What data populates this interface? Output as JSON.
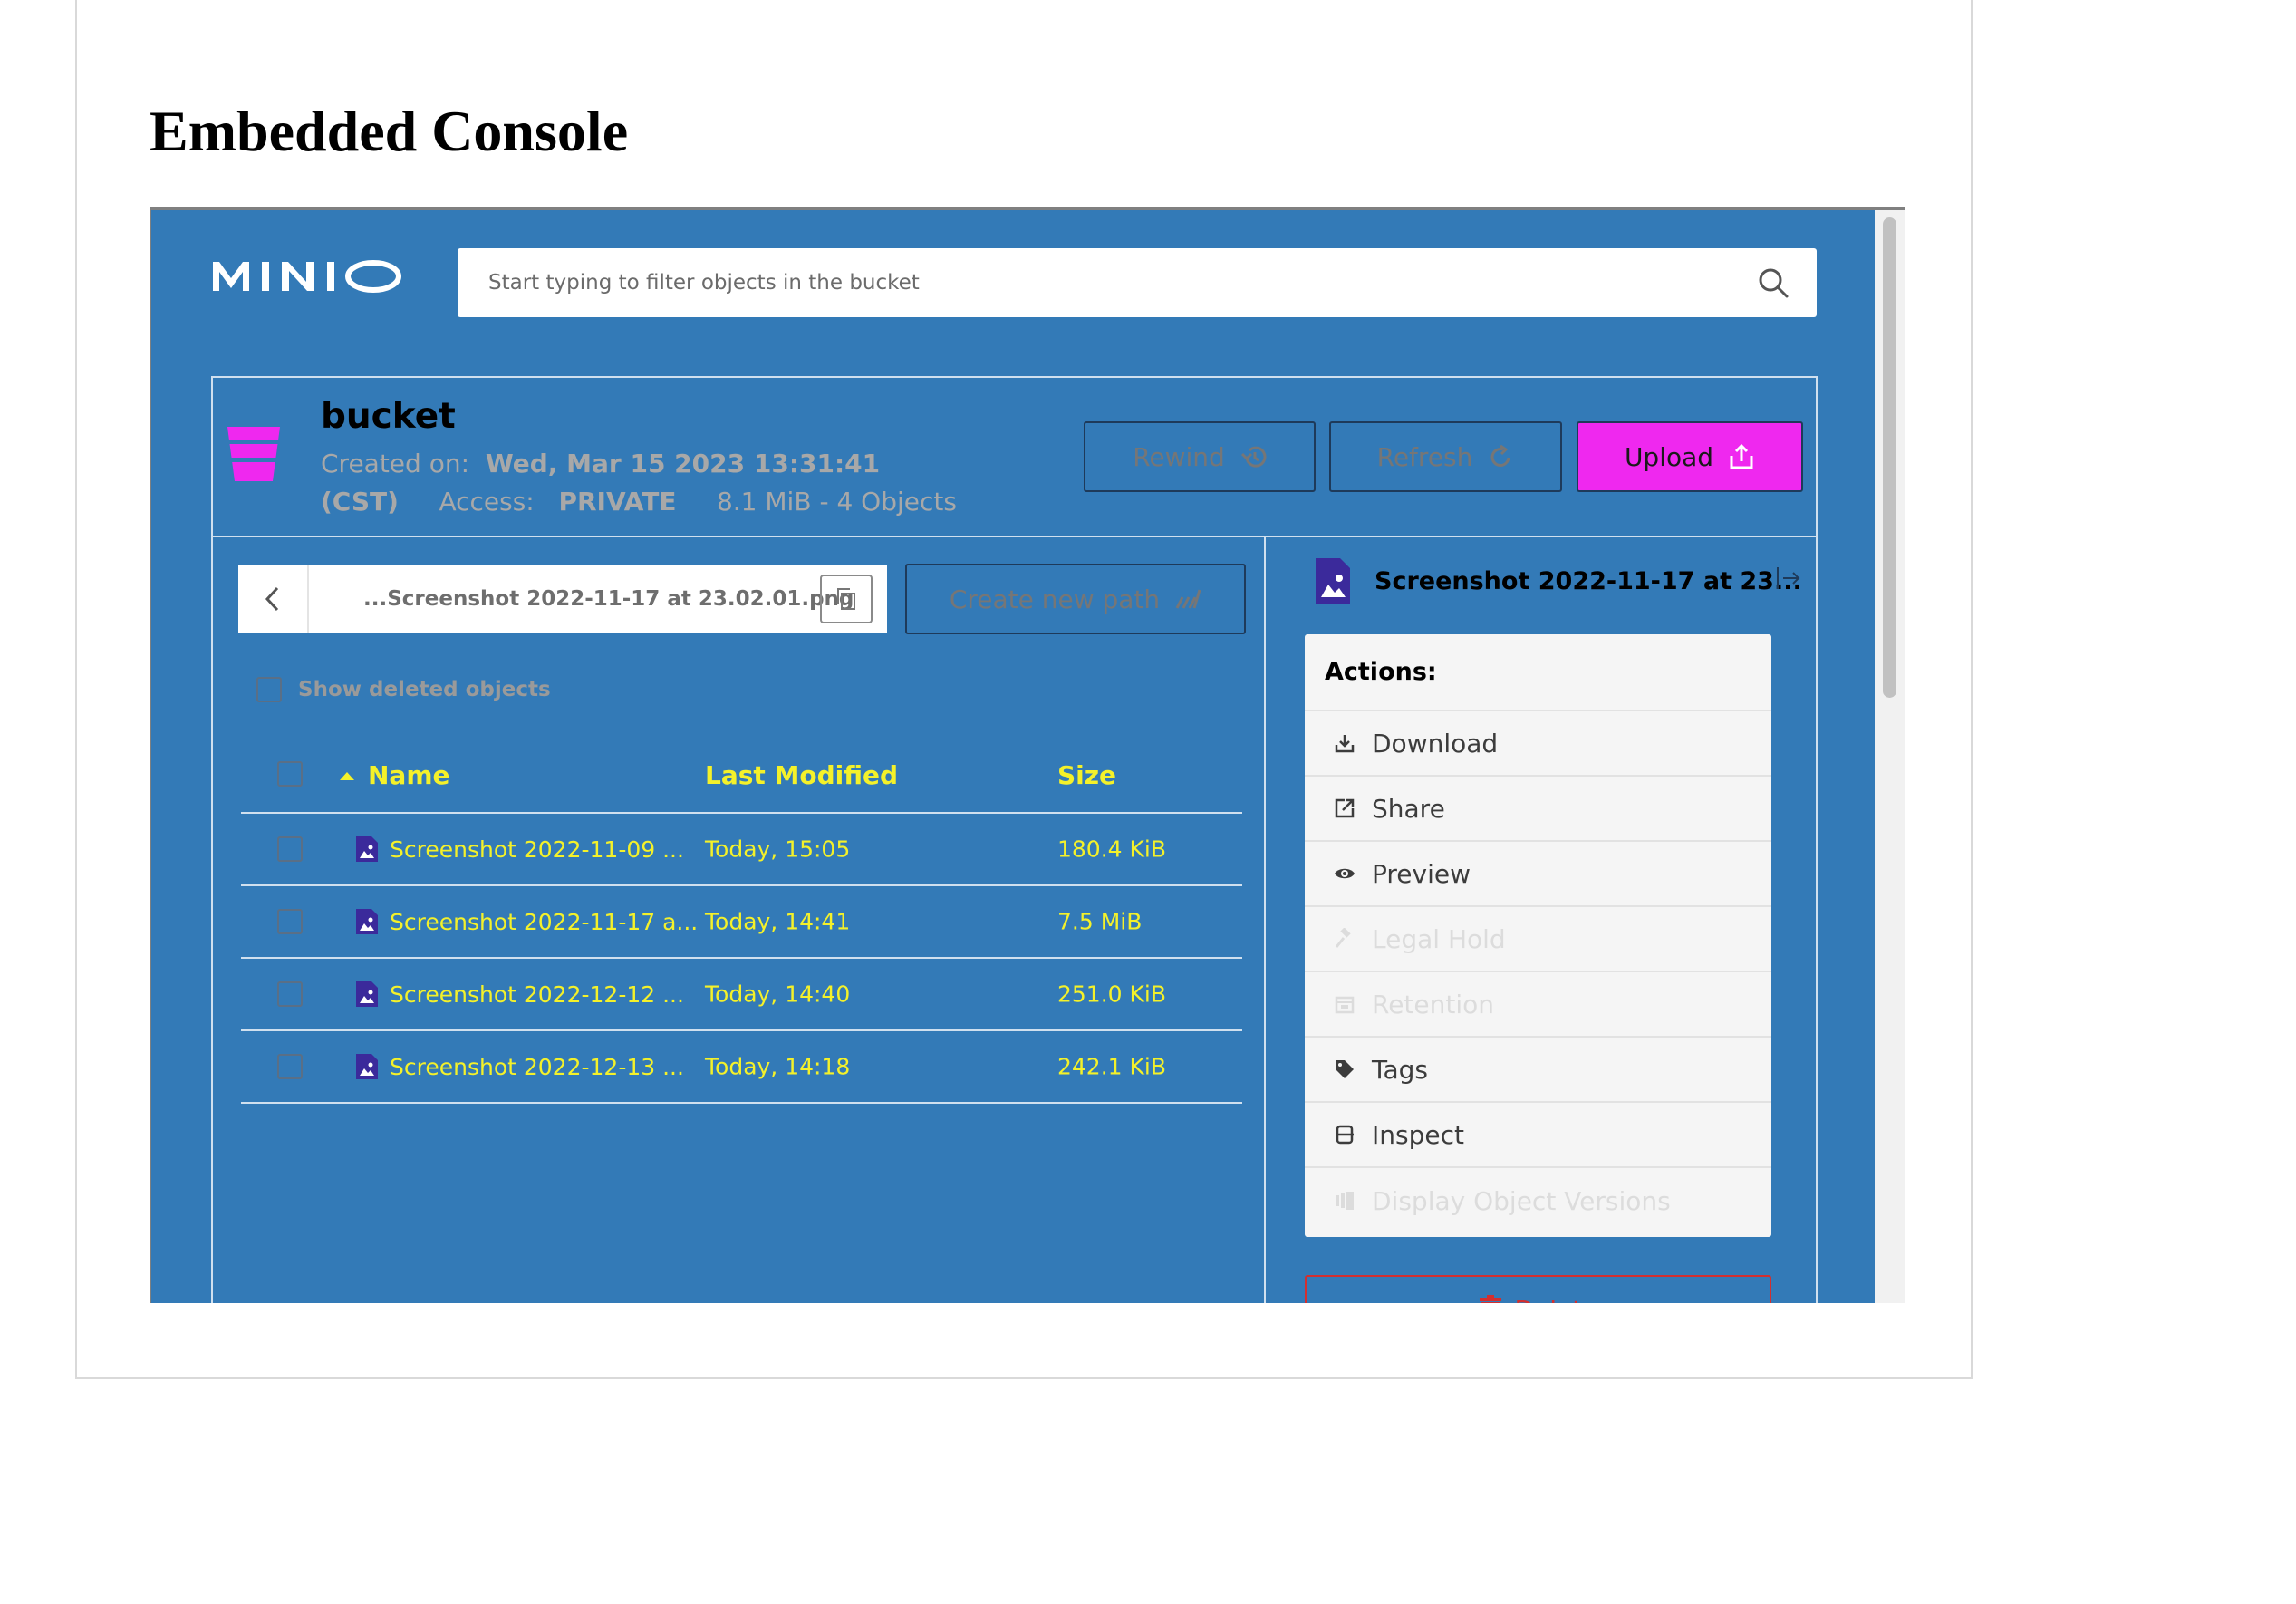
{
  "page": {
    "heading": "Embedded Console"
  },
  "console": {
    "logo_text": "MINIO",
    "search": {
      "placeholder": "Start typing to filter objects in the bucket"
    },
    "bucket": {
      "name": "bucket",
      "created_label": "Created on:",
      "created_value": "Wed, Mar 15 2023 13:31:41",
      "timezone": "(CST)",
      "access_label": "Access:",
      "access_value": "PRIVATE",
      "usage": "8.1 MiB - 4 Objects",
      "icon_color": "#ef28ef"
    },
    "header_buttons": {
      "rewind": "Rewind",
      "refresh": "Refresh",
      "upload": "Upload"
    },
    "path_bar": {
      "path": "...Screenshot 2022-11-17 at 23.02.01.png",
      "create_new_path": "Create new path"
    },
    "show_deleted_label": "Show deleted objects",
    "table": {
      "columns": [
        "Name",
        "Last Modified",
        "Size"
      ],
      "rows": [
        {
          "name": "Screenshot 2022-11-09 ...",
          "modified": "Today, 15:05",
          "size": "180.4 KiB"
        },
        {
          "name": "Screenshot 2022-11-17 a...",
          "modified": "Today, 14:41",
          "size": "7.5 MiB"
        },
        {
          "name": "Screenshot 2022-12-12 ...",
          "modified": "Today, 14:40",
          "size": "251.0 KiB"
        },
        {
          "name": "Screenshot 2022-12-13 ...",
          "modified": "Today, 14:18",
          "size": "242.1 KiB"
        }
      ]
    },
    "detail": {
      "title": "Screenshot 2022-11-17 at 23...",
      "actions_title": "Actions:",
      "actions": [
        {
          "label": "Download",
          "icon": "download-icon",
          "enabled": true
        },
        {
          "label": "Share",
          "icon": "share-icon",
          "enabled": true
        },
        {
          "label": "Preview",
          "icon": "eye-icon",
          "enabled": true
        },
        {
          "label": "Legal Hold",
          "icon": "gavel-icon",
          "enabled": false
        },
        {
          "label": "Retention",
          "icon": "calendar-icon",
          "enabled": false
        },
        {
          "label": "Tags",
          "icon": "tag-icon",
          "enabled": true
        },
        {
          "label": "Inspect",
          "icon": "inspect-icon",
          "enabled": true
        },
        {
          "label": "Display Object Versions",
          "icon": "versions-icon",
          "enabled": false
        }
      ],
      "delete_label": "Delete"
    },
    "colors": {
      "background": "#337ab7",
      "accent_text": "#f4f12a",
      "upload": "#ef28ef",
      "delete": "#d32f2f"
    }
  }
}
